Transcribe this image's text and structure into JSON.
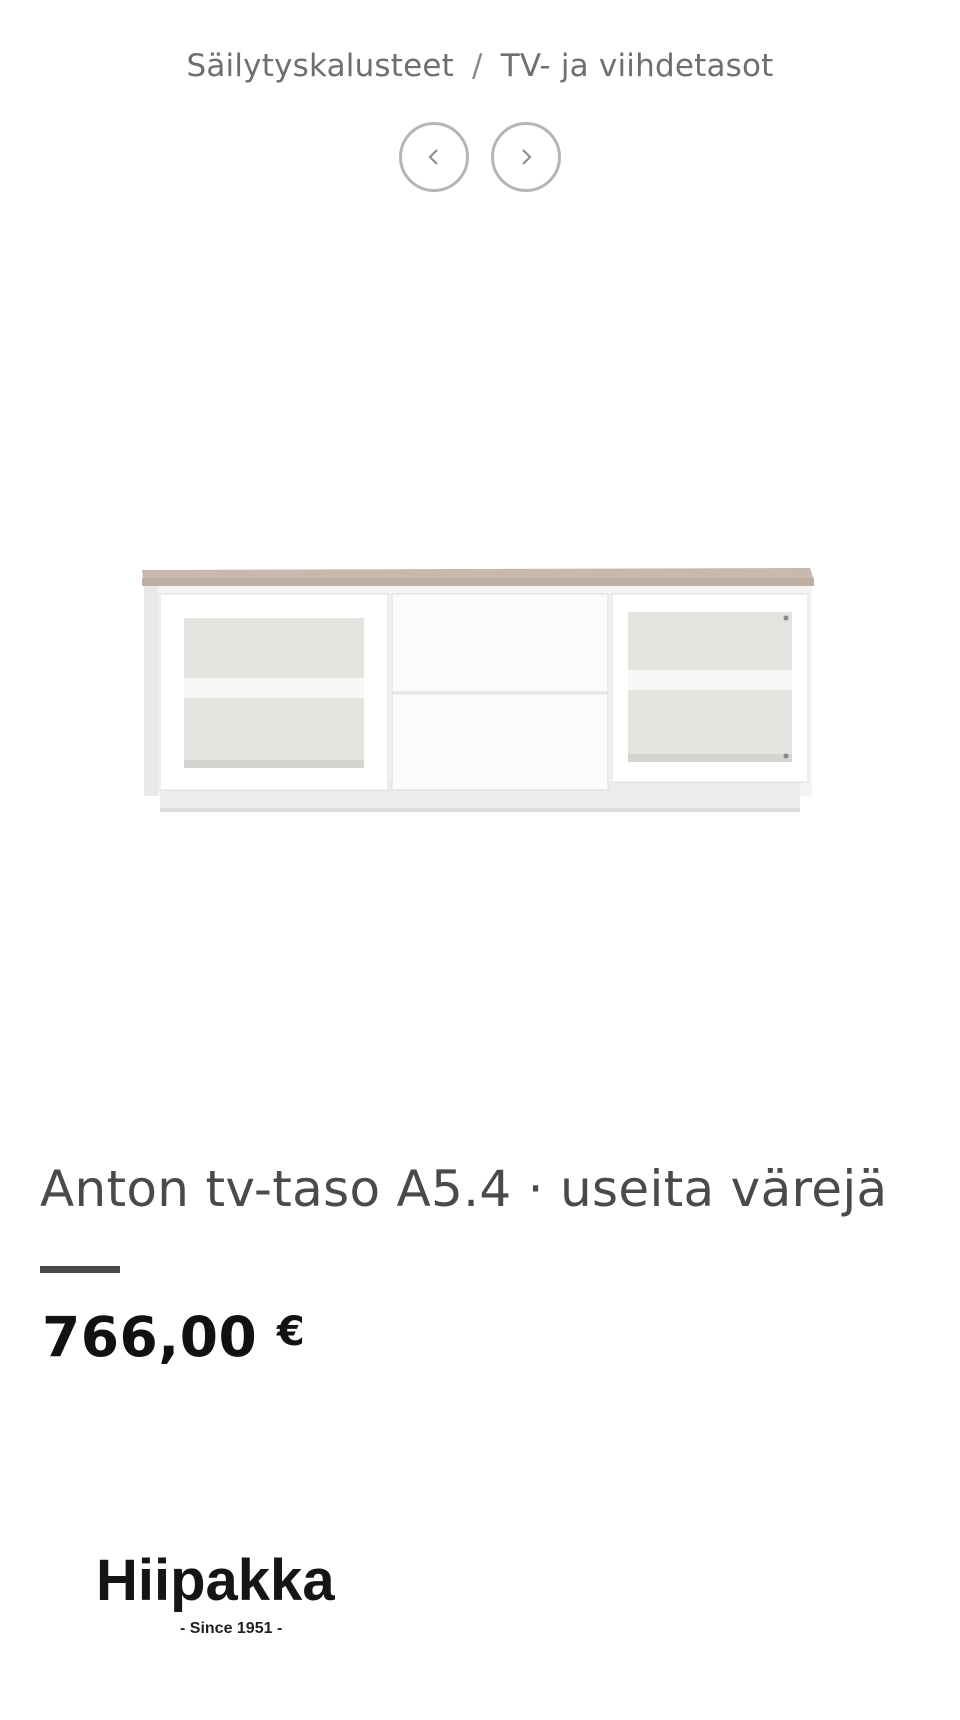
{
  "breadcrumb": {
    "items": [
      "Säilytyskalusteet",
      "TV- ja viihdetasot"
    ],
    "separator": "/"
  },
  "nav": {
    "prev_icon": "chevron-left-icon",
    "next_icon": "chevron-right-icon"
  },
  "product": {
    "title": "Anton tv-taso A5.4 · useita värejä",
    "price_value": "766,00",
    "price_currency": "€"
  },
  "logo": {
    "name": "Hiipakka",
    "tagline": "- Since 1951 -"
  },
  "colors": {
    "text_muted": "#6f6f6f",
    "title": "#4a4a4a",
    "price": "#111111",
    "nav_border": "#b5b5b5"
  }
}
